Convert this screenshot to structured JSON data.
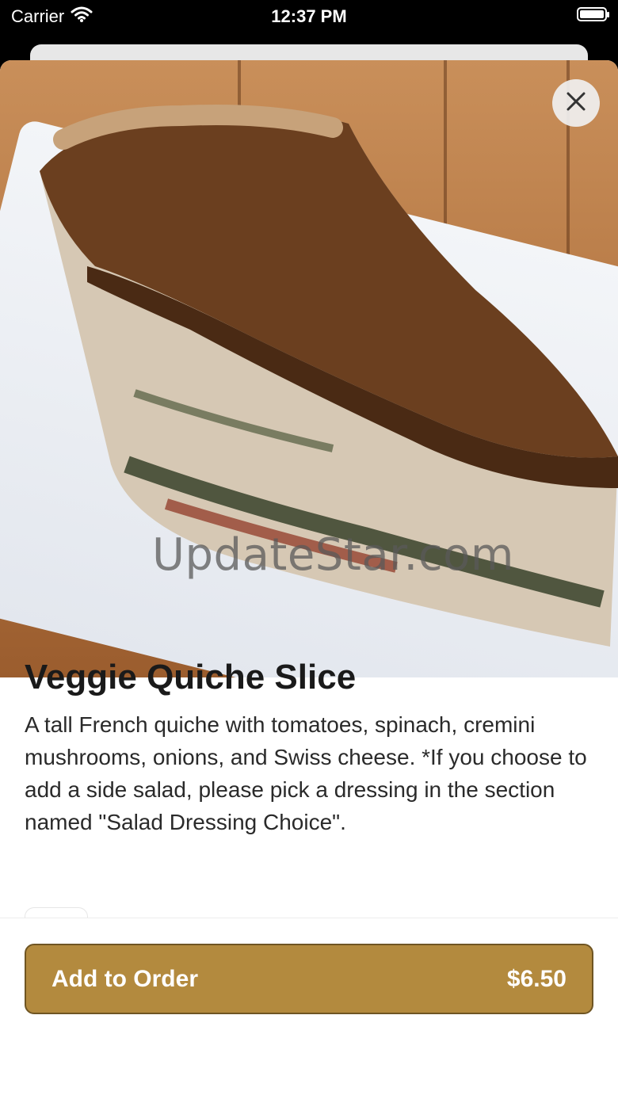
{
  "status": {
    "carrier": "Carrier",
    "time": "12:37 PM"
  },
  "item": {
    "name": "Veggie Quiche Slice",
    "description": "A tall French quiche with tomatoes, spinach, cremini mushrooms, onions, and Swiss cheese. *If you choose to add a side salad, please pick a dressing in the section named \"Salad Dressing Choice\".",
    "image_watermark": "UpdateStar.com"
  },
  "footer": {
    "button_label": "Add to Order",
    "price": "$6.50"
  },
  "colors": {
    "accent": "#b38a3e",
    "accent_border": "#6f5523"
  },
  "icons": {
    "close": "close-icon",
    "wifi": "wifi-icon",
    "battery": "battery-icon"
  }
}
